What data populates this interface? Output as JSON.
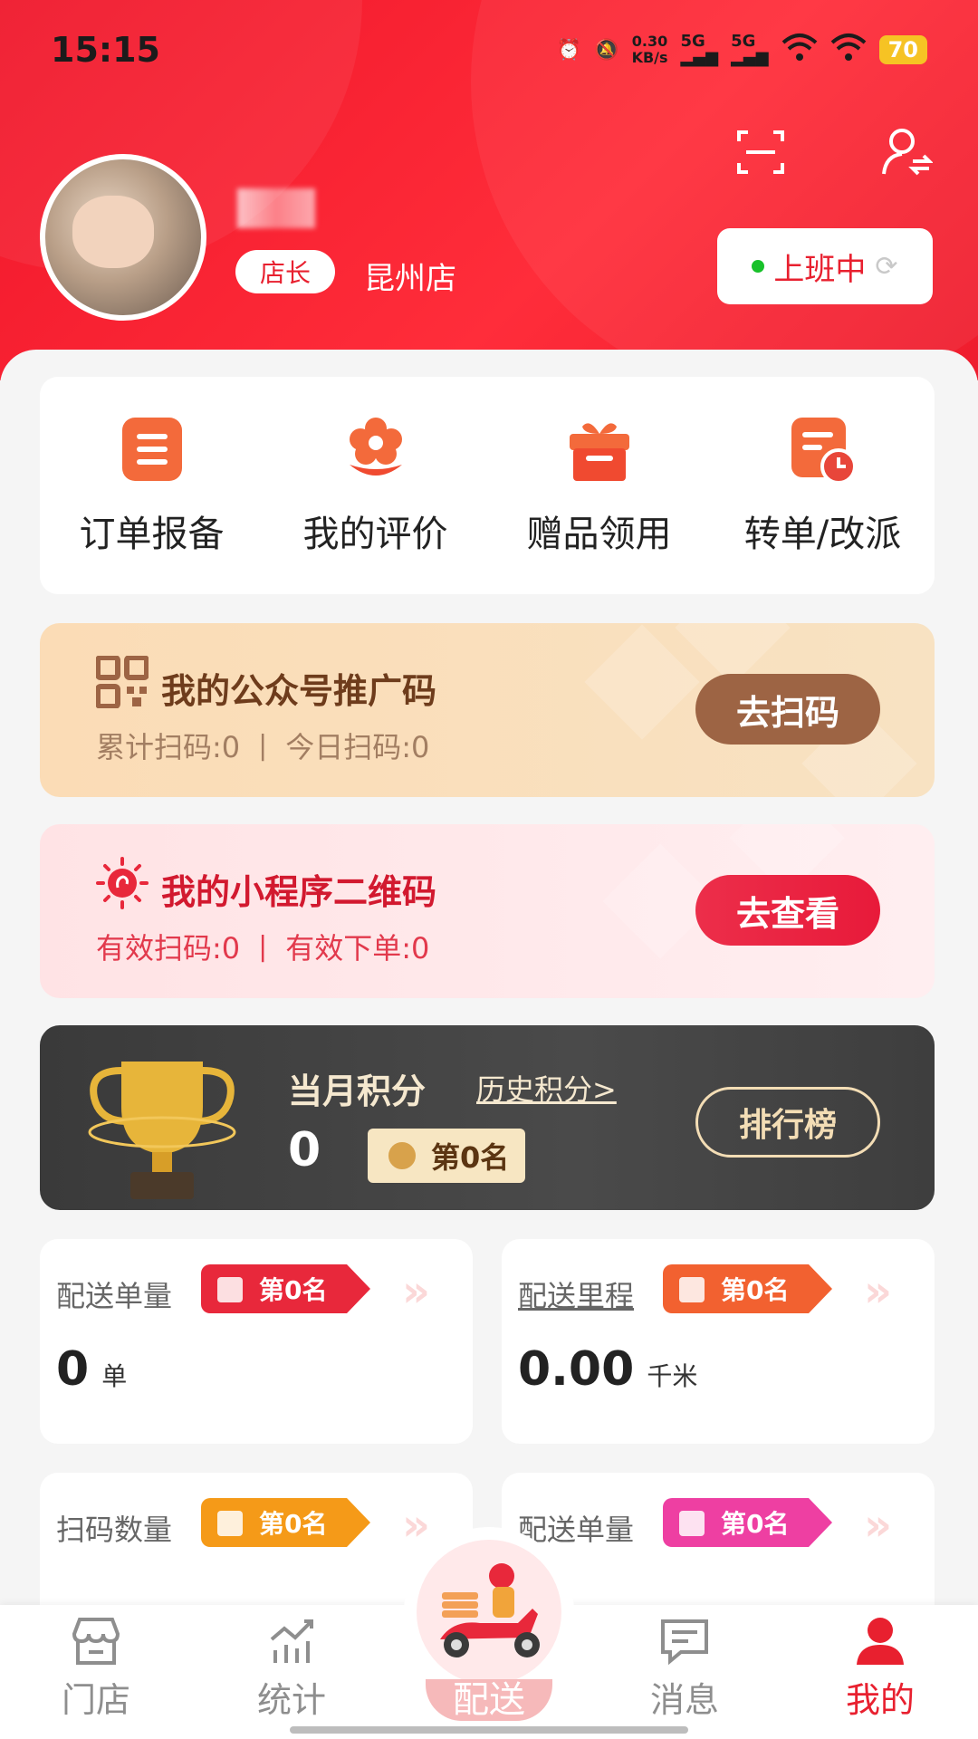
{
  "status_bar": {
    "time": "15:15",
    "net_speed": "0.30",
    "net_unit": "KB/s",
    "sim1": "5G",
    "sim2": "5G",
    "battery": "70"
  },
  "profile": {
    "role": "店长",
    "store": "昆州店",
    "duty_status": "上班中"
  },
  "quick_actions": [
    {
      "label": "订单报备",
      "icon": "order-report-icon"
    },
    {
      "label": "我的评价",
      "icon": "flower-review-icon"
    },
    {
      "label": "赠品领用",
      "icon": "gift-icon"
    },
    {
      "label": "转单/改派",
      "icon": "reassign-clock-icon"
    }
  ],
  "official_qr": {
    "title": "我的公众号推广码",
    "total_label": "累计扫码:0",
    "today_label": "今日扫码:0",
    "button": "去扫码"
  },
  "mini_qr": {
    "title": "我的小程序二维码",
    "valid_scan": "有效扫码:0",
    "valid_order": "有效下单:0",
    "button": "去查看"
  },
  "points": {
    "title": "当月积分",
    "history": "历史积分>",
    "value": "0",
    "rank": "第0名",
    "button": "排行榜"
  },
  "stats": [
    {
      "title": "配送单量",
      "rank": "第0名",
      "value": "0",
      "unit": "单"
    },
    {
      "title": "配送里程",
      "rank": "第0名",
      "value": "0.00",
      "unit": "千米"
    },
    {
      "title": "扫码数量",
      "rank": "第0名"
    },
    {
      "title": "配送单量",
      "rank": "第0名"
    }
  ],
  "tabs": [
    {
      "label": "门店",
      "icon": "store-icon"
    },
    {
      "label": "统计",
      "icon": "stats-chart-icon"
    },
    {
      "label": "配送",
      "icon": "delivery-scooter-icon"
    },
    {
      "label": "消息",
      "icon": "message-icon"
    },
    {
      "label": "我的",
      "icon": "user-icon"
    }
  ],
  "colors": {
    "brand_red": "#e8202f",
    "gold_button": "#9d6444",
    "pink_button": "#e81a3a"
  }
}
